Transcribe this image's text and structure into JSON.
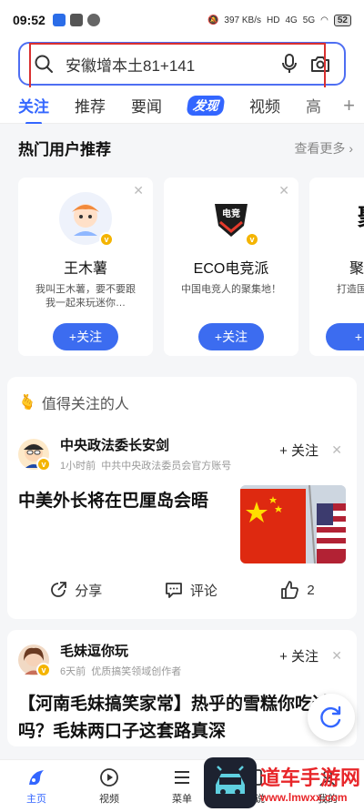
{
  "status_bar": {
    "time": "09:52",
    "net_speed": "397",
    "net_unit": "KB/s",
    "hd": "HD",
    "signal1": "4G",
    "signal2": "5G",
    "battery": "52"
  },
  "search": {
    "query": "安徽增本土81+141"
  },
  "tabs": [
    {
      "label": "关注"
    },
    {
      "label": "推荐"
    },
    {
      "label": "要闻"
    },
    {
      "label": "发现"
    },
    {
      "label": "视频"
    },
    {
      "label": "高"
    }
  ],
  "hot_users": {
    "title": "热门用户推荐",
    "see_more": "查看更多",
    "cards": [
      {
        "name": "王木薯",
        "desc": "我叫王木薯，要不要跟我一起来玩迷你…",
        "follow": "+关注"
      },
      {
        "name": "ECO电竞派",
        "desc": "中国电竞人的聚集地！",
        "follow": "+关注"
      },
      {
        "name": "聚印",
        "desc": "打造国内视频作品",
        "follow": "+"
      }
    ]
  },
  "worth_following": {
    "title": "值得关注的人",
    "post": {
      "author": "中央政法委长安剑",
      "time": "1小时前",
      "source": "中共中央政法委员会官方账号",
      "follow": "+ 关注",
      "headline": "中美外长将在巴厘岛会晤",
      "share": "分享",
      "comment": "评论",
      "likes": "2"
    }
  },
  "post2": {
    "author": "毛妹逗你玩",
    "time": "6天前",
    "source": "优质搞笑领域创作者",
    "follow": "+ 关注",
    "text": "【河南毛妹搞笑家常】热乎的雪糕你吃过吗？毛妹两口子这套路真深"
  },
  "bottom_nav": [
    {
      "label": "主页",
      "icon": "home-icon"
    },
    {
      "label": "视频",
      "icon": "play-icon"
    },
    {
      "label": "菜单",
      "icon": "menu-icon"
    },
    {
      "label": "小说",
      "icon": "book-icon"
    },
    {
      "label": "我的",
      "icon": "user-icon"
    }
  ],
  "watermark": {
    "main": "道车手游网",
    "sub": "www.lmwxx.com"
  },
  "colors": {
    "accent": "#3366ff",
    "follow_pill": "#3c6cf0",
    "highlight_box": "#d93030"
  }
}
